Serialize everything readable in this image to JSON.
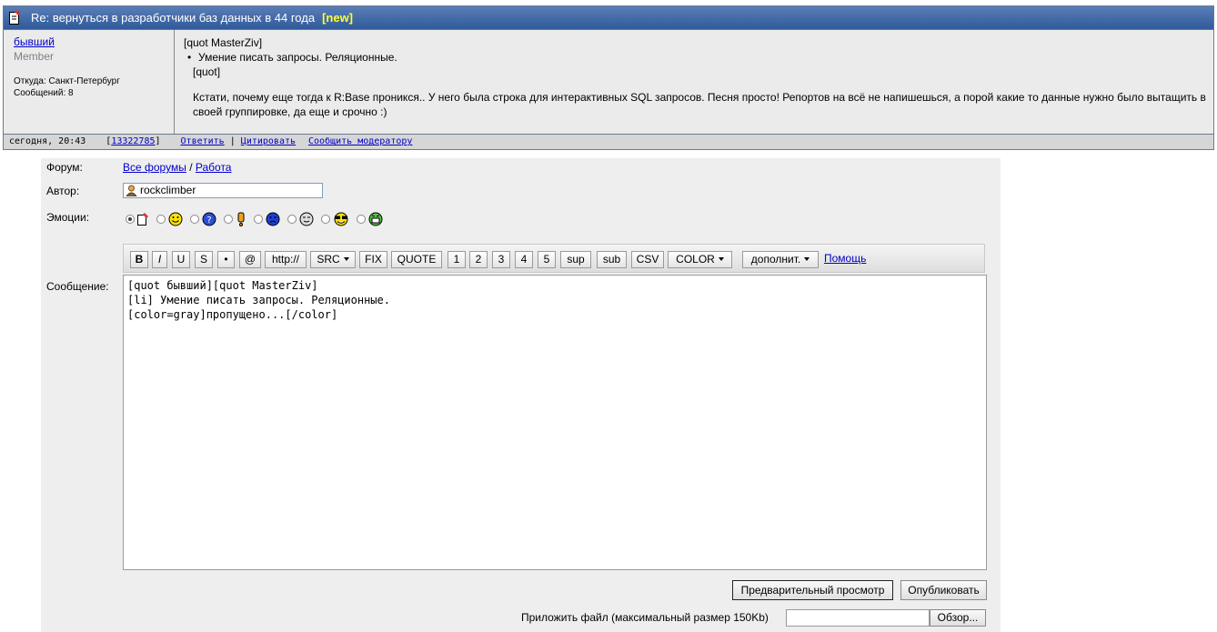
{
  "post": {
    "title": "Re: вернуться в разработчики баз данных в 44 года",
    "new_badge": "[new]",
    "author": "бывший",
    "role": "Member",
    "location": "Откуда: Санкт-Петербург",
    "messages": "Сообщений: 8",
    "body": {
      "quote_open": "[quot MasterZiv]",
      "list_item": "Умение писать запросы. Реляционные.",
      "quote_close": "[quot]",
      "paragraph": "Кстати, почему еще тогда к R:Base проникся.. У него была строка для интерактивных SQL запросов. Песня просто! Репортов на всё не напишешься, а порой какие то данные нужно было вытащить в своей группировке, да еще и срочно :)"
    },
    "footer": {
      "time": "сегодня, 20:43",
      "id": "[13322785]",
      "reply": "Ответить",
      "separator": "|",
      "quote": "Цитировать",
      "report": "Сообщить модератору"
    }
  },
  "form": {
    "labels": {
      "forum": "Форум:",
      "author": "Автор:",
      "emotions": "Эмоции:",
      "message": "Сообщение:"
    },
    "forum_links": {
      "all": "Все форумы",
      "sep": "/",
      "current": "Работа"
    },
    "author_value": "rockclimber",
    "emotions": [
      "note-icon",
      "smile-icon",
      "question-icon",
      "exclamation-icon",
      "sad-icon",
      "wink-icon",
      "cool-icon",
      "laugh-icon"
    ],
    "toolbar": {
      "bold": "B",
      "italic": "I",
      "underline": "U",
      "strike": "S",
      "bullet": "•",
      "at": "@",
      "http": "http://",
      "src": "SRC",
      "fix": "FIX",
      "quote": "QUOTE",
      "h1": "1",
      "h2": "2",
      "h3": "3",
      "h4": "4",
      "h5": "5",
      "sup": "sup",
      "sub": "sub",
      "csv": "CSV",
      "color": "COLOR",
      "more": "дополнит.",
      "help": "Помощь"
    },
    "editor_text": "[quot бывший][quot MasterZiv]\n[li] Умение писать запросы. Реляционные.\n[color=gray]пропущено...[/color]",
    "buttons": {
      "preview": "Предварительный просмотр",
      "publish": "Опубликовать"
    },
    "attach_label": "Приложить файл (максимальный размер 150Kb)",
    "browse": "Обзор..."
  },
  "colors": {
    "header_bg": "#3a64a2",
    "new_badge": "#ffff33",
    "link": "#0000cc",
    "form_bg": "#eeeeee"
  }
}
